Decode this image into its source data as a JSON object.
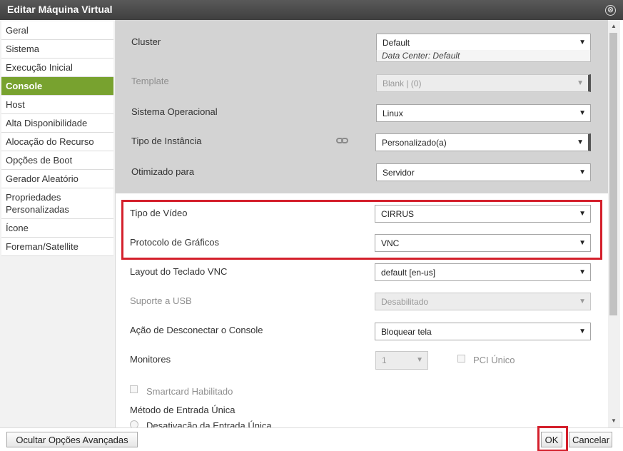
{
  "dialog": {
    "title": "Editar Máquina Virtual",
    "close_glyph": "⊗"
  },
  "sidebar": {
    "items": [
      {
        "label": "Geral"
      },
      {
        "label": "Sistema"
      },
      {
        "label": "Execução Inicial"
      },
      {
        "label": "Console",
        "active": true
      },
      {
        "label": "Host"
      },
      {
        "label": "Alta Disponibilidade"
      },
      {
        "label": "Alocação do Recurso"
      },
      {
        "label": "Opções de Boot"
      },
      {
        "label": "Gerador Aleatório"
      },
      {
        "label": "Propriedades Personalizadas"
      },
      {
        "label": "Ícone"
      },
      {
        "label": "Foreman/Satellite"
      }
    ]
  },
  "general": {
    "cluster": {
      "label": "Cluster",
      "value": "Default",
      "sub": "Data Center: Default"
    },
    "template": {
      "label": "Template",
      "value": "Blank | (0)"
    },
    "os": {
      "label": "Sistema Operacional",
      "value": "Linux"
    },
    "instance_type": {
      "label": "Tipo de Instância",
      "value": "Personalizado(a)"
    },
    "optimized_for": {
      "label": "Otimizado para",
      "value": "Servidor"
    }
  },
  "console": {
    "video_type": {
      "label": "Tipo de Vídeo",
      "value": "CIRRUS"
    },
    "graphics_protocol": {
      "label": "Protocolo de Gráficos",
      "value": "VNC"
    },
    "vnc_keyboard": {
      "label": "Layout do Teclado VNC",
      "value": "default [en-us]"
    },
    "usb_support": {
      "label": "Suporte a USB",
      "value": "Desabilitado"
    },
    "disconnect_action": {
      "label": "Ação de Desconectar o Console",
      "value": "Bloquear tela"
    },
    "monitors": {
      "label": "Monitores",
      "value": "1"
    },
    "single_pci": {
      "label": "PCI Único"
    },
    "smartcard": {
      "label": "Smartcard Habilitado"
    },
    "sso": {
      "label": "Método de Entrada Única",
      "option_disable": "Desativação da Entrada Única"
    }
  },
  "footer": {
    "advanced_label": "Ocultar Opções Avançadas",
    "ok_label": "OK",
    "cancel_label": "Cancelar"
  },
  "colors": {
    "active_nav": "#78a22f",
    "highlight": "#d4202c",
    "title_bar": "#4a4a4a"
  },
  "icons": {
    "dropdown": "▼",
    "scroll_up": "▲",
    "scroll_down": "▼"
  }
}
